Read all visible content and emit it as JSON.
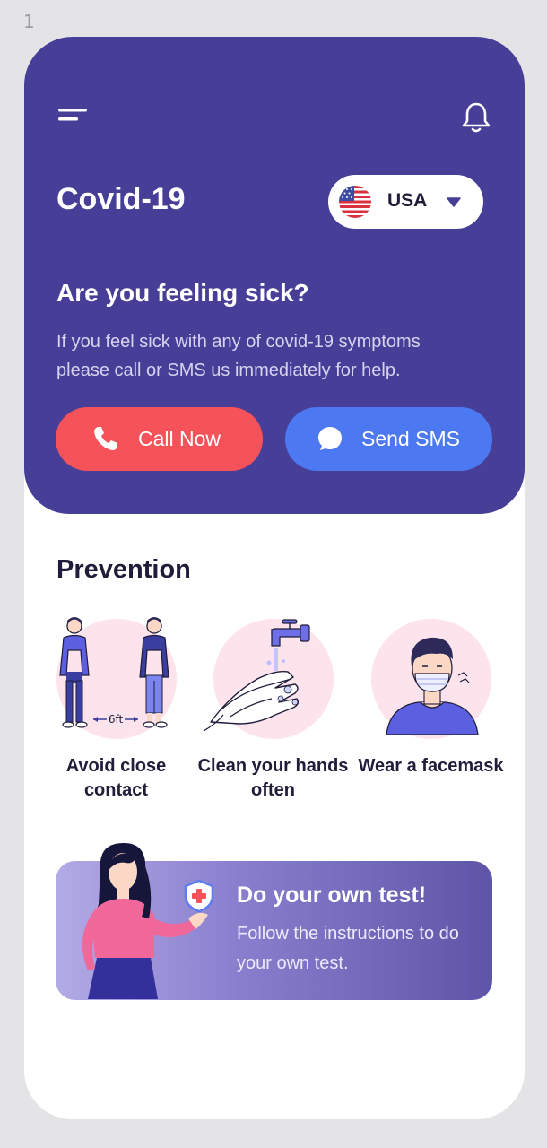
{
  "frame": {
    "number": "1"
  },
  "header": {
    "title": "Covid-19",
    "country": {
      "selected": "USA"
    },
    "sick": {
      "heading": "Are you feeling sick?",
      "description": "If you feel sick with any of covid-19 symptoms please call or SMS us immediately for help."
    },
    "buttons": {
      "call": "Call Now",
      "sms": "Send SMS"
    }
  },
  "prevention": {
    "title": "Prevention",
    "distance_label": "6ft",
    "items": [
      {
        "label": "Avoid close contact",
        "icon": "social-distance-illustration"
      },
      {
        "label": "Clean your hands often",
        "icon": "handwashing-illustration"
      },
      {
        "label": "Wear a facemask",
        "icon": "facemask-illustration"
      }
    ]
  },
  "test_card": {
    "title": "Do your own test!",
    "description": "Follow the instructions to do your own test."
  },
  "colors": {
    "header": "#473f97",
    "call": "#f5525a",
    "sms": "#4c79f2",
    "accent_pink": "#fce3ec"
  }
}
